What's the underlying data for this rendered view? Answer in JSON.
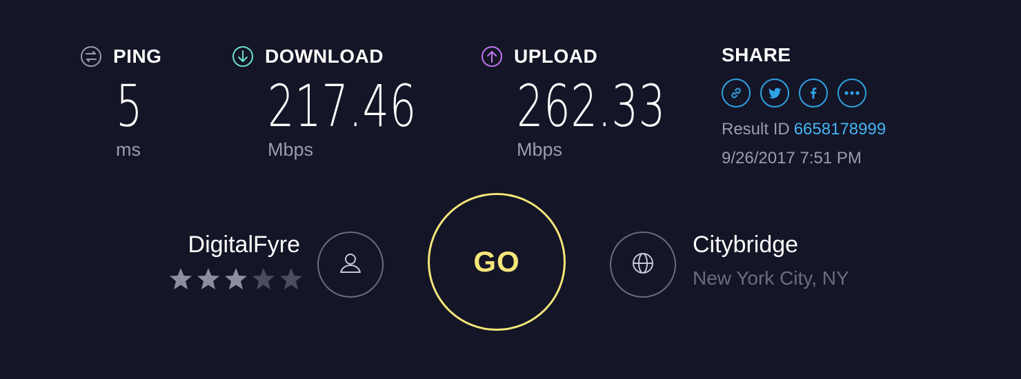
{
  "metrics": {
    "ping": {
      "label": "PING",
      "value": "5",
      "unit": "ms",
      "icon": "ping-icon",
      "icon_color": "#9b9cb0"
    },
    "download": {
      "label": "DOWNLOAD",
      "value": "217.46",
      "unit": "Mbps",
      "icon": "download-arrow-icon",
      "icon_color": "#6fe3d6"
    },
    "upload": {
      "label": "UPLOAD",
      "value": "262.33",
      "unit": "Mbps",
      "icon": "upload-arrow-icon",
      "icon_color": "#c178f0"
    }
  },
  "share": {
    "label": "SHARE",
    "buttons": [
      {
        "name": "link-icon"
      },
      {
        "name": "twitter-icon"
      },
      {
        "name": "facebook-icon"
      },
      {
        "name": "more-icon"
      }
    ],
    "result_label": "Result ID",
    "result_id": "6658178999",
    "datetime": "9/26/2017 7:51 PM"
  },
  "isp": {
    "name": "DigitalFyre",
    "rating": 3,
    "rating_max": 5,
    "icon": "user-icon"
  },
  "go": {
    "label": "GO"
  },
  "server": {
    "name": "Citybridge",
    "location": "New York City, NY",
    "icon": "globe-icon"
  },
  "colors": {
    "background": "#141526",
    "go_accent": "#f5e67a",
    "share_accent": "#2fa3e6",
    "muted_text": "#9b9cb0",
    "dim_text": "#6b6c80"
  }
}
